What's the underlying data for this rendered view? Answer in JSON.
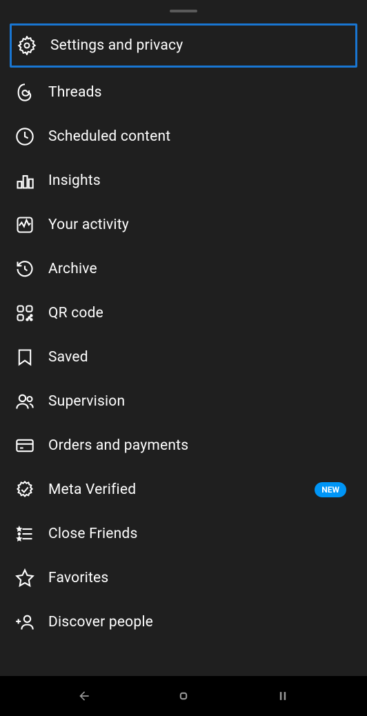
{
  "menu": {
    "items": [
      {
        "label": "Settings and privacy",
        "icon": "gear-icon",
        "highlighted": true
      },
      {
        "label": "Threads",
        "icon": "threads-icon"
      },
      {
        "label": "Scheduled content",
        "icon": "clock-icon"
      },
      {
        "label": "Insights",
        "icon": "bar-chart-icon"
      },
      {
        "label": "Your activity",
        "icon": "activity-icon"
      },
      {
        "label": "Archive",
        "icon": "archive-icon"
      },
      {
        "label": "QR code",
        "icon": "qr-code-icon"
      },
      {
        "label": "Saved",
        "icon": "bookmark-icon"
      },
      {
        "label": "Supervision",
        "icon": "people-icon"
      },
      {
        "label": "Orders and payments",
        "icon": "card-icon"
      },
      {
        "label": "Meta Verified",
        "icon": "verified-icon",
        "badge": "NEW"
      },
      {
        "label": "Close Friends",
        "icon": "close-friends-icon"
      },
      {
        "label": "Favorites",
        "icon": "star-icon"
      },
      {
        "label": "Discover people",
        "icon": "discover-people-icon"
      }
    ]
  }
}
